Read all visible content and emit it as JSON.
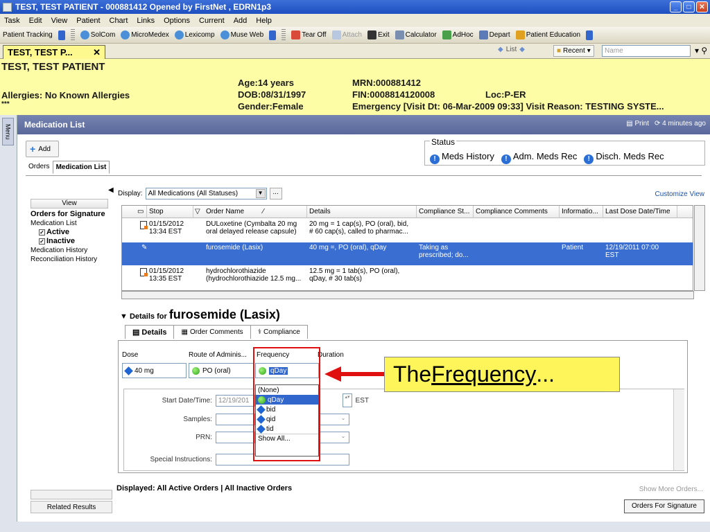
{
  "window": {
    "title": "TEST, TEST PATIENT - 000881412 Opened by FirstNet , EDRN1p3"
  },
  "menu": [
    "Task",
    "Edit",
    "View",
    "Patient",
    "Chart",
    "Links",
    "Options",
    "Current",
    "Add",
    "Help"
  ],
  "toolbar": {
    "patient_tracking": "Patient Tracking",
    "solcom": "SolCom",
    "micromedex": "MicroMedex",
    "lexicomp": "Lexicomp",
    "muse_web": "Muse Web",
    "tear_off": "Tear Off",
    "attach": "Attach",
    "exit": "Exit",
    "calculator": "Calculator",
    "adhoc": "AdHoc",
    "depart": "Depart",
    "patient_education": "Patient Education"
  },
  "patient_tab": {
    "label": "TEST, TEST P...",
    "list_label": "List",
    "recent_label": "Recent",
    "name_placeholder": "Name"
  },
  "banner": {
    "name": "TEST, TEST PATIENT",
    "allergies": "Allergies: No Known Allergies",
    "stars": "***",
    "age": "Age:14 years",
    "dob": "DOB:08/31/1997",
    "gender": "Gender:Female",
    "mrn": "MRN:000881412",
    "fin": "FIN:0008814120008",
    "loc": "Loc:P-ER",
    "visit": "Emergency [Visit Dt: 06-Mar-2009 09:33] Visit Reason: TESTING SYSTE..."
  },
  "rail": {
    "menu_label": "Menu"
  },
  "medlist": {
    "header": "Medication List",
    "print": "Print",
    "refreshed": "4 minutes ago",
    "add": "Add",
    "status_legend": "Status",
    "status_meds_history": "Meds History",
    "status_adm_meds_rec": "Adm. Meds Rec",
    "status_disch_meds_rec": "Disch. Meds Rec",
    "tabs": [
      "Orders",
      "Medication List"
    ],
    "display_label": "Display:",
    "display_value": "All Medications (All Statuses)",
    "customize": "Customize View"
  },
  "left_panel": {
    "view_header": "View",
    "items": [
      "Orders for Signature",
      "Medication List",
      "Active",
      "Inactive",
      "Medication History",
      "Reconciliation History"
    ],
    "related": "Related Results"
  },
  "grid": {
    "columns": [
      "Stop",
      "Order Name",
      "Details",
      "Compliance St...",
      "Compliance Comments",
      "Informatio...",
      "Last Dose Date/Time"
    ],
    "rows": [
      {
        "stop1": "01/15/2012",
        "stop2": "13:34 EST",
        "name1": "DULoxetine (Cymbalta 20 mg",
        "name2": "oral delayed release capsule)",
        "det1": "20 mg = 1 cap(s), PO (oral), bid,",
        "det2": "# 60 cap(s), called to pharmac...",
        "comp1": "",
        "comp2": "",
        "info": "",
        "last1": "",
        "last2": ""
      },
      {
        "stop1": "",
        "stop2": "",
        "name1": "furosemide (Lasix)",
        "name2": "",
        "det1": "40 mg =, PO (oral), qDay",
        "det2": "",
        "comp1": "Taking as",
        "comp2": "prescribed; do...",
        "info": "Patient",
        "last1": "12/19/2011 07:00",
        "last2": "EST"
      },
      {
        "stop1": "01/15/2012",
        "stop2": "13:35 EST",
        "name1": "hydrochlorothiazide",
        "name2": "(hydrochlorothiazide 12.5 mg...",
        "det1": "12.5 mg = 1 tab(s), PO (oral),",
        "det2": "qDay, # 30 tab(s)",
        "comp1": "",
        "comp2": "",
        "info": "",
        "last1": "",
        "last2": ""
      }
    ]
  },
  "details": {
    "prefix": "Details for",
    "drug": "furosemide (Lasix)",
    "tabs": [
      "Details",
      "Order Comments",
      "Compliance"
    ],
    "dose_label": "Dose",
    "route_label": "Route of Adminis...",
    "frequency_label": "Frequency",
    "duration_label": "Duration",
    "dose_value": "40 mg",
    "route_value": "PO (oral)",
    "frequency_value": "qDay",
    "start_label": "Start Date/Time:",
    "start_value": "12/19/201",
    "start_tz": "EST",
    "samples_label": "Samples:",
    "prn_label": "PRN:",
    "special_label": "Special Instructions:"
  },
  "frequency_dropdown": {
    "options": [
      "(None)",
      "qDay",
      "bid",
      "qid",
      "tid",
      "Show All..."
    ]
  },
  "callout": {
    "prefix": "The ",
    "underlined": "Frequency",
    "suffix": "..."
  },
  "footer": {
    "displayed": "Displayed: All Active Orders",
    "sep": "|",
    "inactive": "All Inactive Orders",
    "show_more": "Show More Orders...",
    "sign": "Orders For Signature"
  }
}
